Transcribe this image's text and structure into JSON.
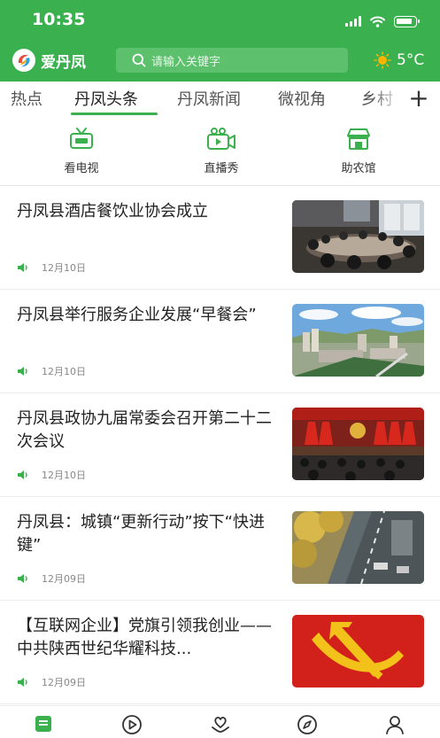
{
  "status_bar": {
    "time": "10:35"
  },
  "header": {
    "app_name": "爱丹凤",
    "search_placeholder": "请输入关键字",
    "weather": {
      "temperature": "5°C",
      "icon": "sun-icon"
    }
  },
  "tabs": [
    {
      "label": "热点",
      "active": false
    },
    {
      "label": "丹凤头条",
      "active": true
    },
    {
      "label": "丹凤新闻",
      "active": false
    },
    {
      "label": "微视角",
      "active": false
    },
    {
      "label": "乡村",
      "active": false
    }
  ],
  "add_tab_label": "+",
  "shortcuts": [
    {
      "label": "看电视",
      "icon": "tv-icon"
    },
    {
      "label": "直播秀",
      "icon": "video-camera-icon"
    },
    {
      "label": "助农馆",
      "icon": "store-icon"
    }
  ],
  "news": [
    {
      "title": "丹凤县酒店餐饮业协会成立",
      "date": "12月10日",
      "image": "meeting-room-photo"
    },
    {
      "title": "丹凤县举行服务企业发展“早餐会”",
      "date": "12月10日",
      "image": "city-aerial-photo"
    },
    {
      "title": "丹凤县政协九届常委会召开第二十二次会议",
      "date": "12月10日",
      "image": "conference-hall-photo"
    },
    {
      "title": "丹凤县：城镇“更新行动”按下“快进键”",
      "date": "12月09日",
      "image": "street-photo"
    },
    {
      "title": "【互联网企业】党旗引领我创业——中共陕西世纪华耀科技...",
      "date": "12月09日",
      "image": "party-flag-photo"
    }
  ],
  "bottom_nav": [
    {
      "icon": "home-icon",
      "active": true
    },
    {
      "icon": "video-play-icon",
      "active": false
    },
    {
      "icon": "service-icon",
      "active": false
    },
    {
      "icon": "discover-icon",
      "active": false
    },
    {
      "icon": "profile-icon",
      "active": false
    }
  ],
  "colors": {
    "brand_green": "#3bb04f",
    "text": "#222222",
    "muted": "#888888"
  }
}
